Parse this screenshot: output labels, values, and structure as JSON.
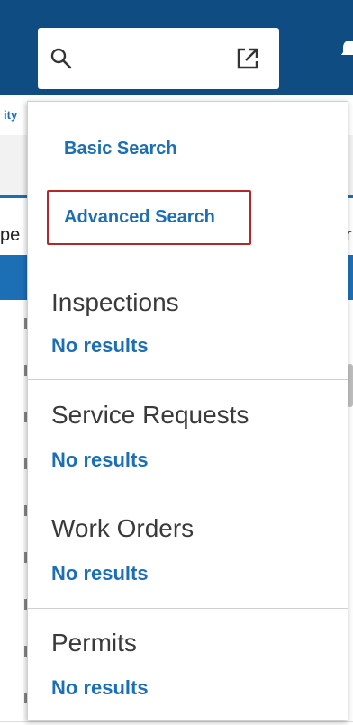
{
  "colors": {
    "header": "#0f4c81",
    "link": "#1d6fb5",
    "highlight_border": "#b3282d"
  },
  "header": {
    "search_icon": "search-icon",
    "popout_icon": "external-link-icon",
    "bell_icon": "bell-icon"
  },
  "background": {
    "partial_tab_label": "ity",
    "partial_heading": "pe",
    "partial_heading_right": "r"
  },
  "dropdown": {
    "basic_search_label": "Basic Search",
    "advanced_search_label": "Advanced Search",
    "sections": [
      {
        "title": "Inspections",
        "result": "No results"
      },
      {
        "title": "Service Requests",
        "result": "No results"
      },
      {
        "title": "Work Orders",
        "result": "No results"
      },
      {
        "title": "Permits",
        "result": "No results"
      }
    ]
  }
}
